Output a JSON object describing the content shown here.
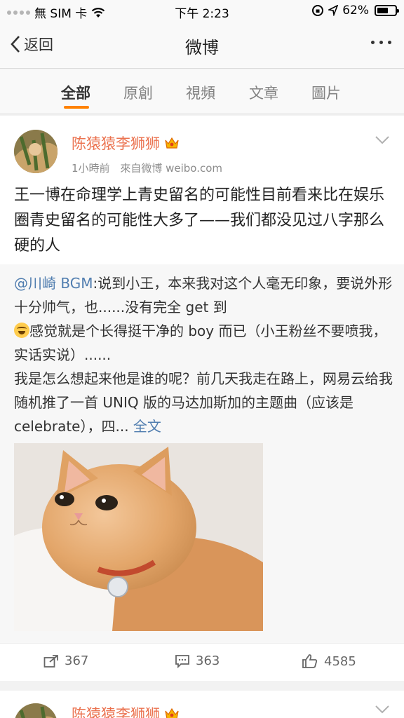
{
  "status_bar": {
    "carrier": "無 SIM 卡",
    "time": "下午 2:23",
    "battery_percent": "62%",
    "battery_level": 0.62
  },
  "nav": {
    "back_label": "返回",
    "title": "微博"
  },
  "tabs": [
    {
      "label": "全部",
      "active": true
    },
    {
      "label": "原創",
      "active": false
    },
    {
      "label": "視頻",
      "active": false
    },
    {
      "label": "文章",
      "active": false
    },
    {
      "label": "圖片",
      "active": false
    }
  ],
  "post": {
    "username": "陈猿猿李狮狮",
    "time_ago": "1小時前",
    "source": "來自微博 weibo.com",
    "text": "王一博在命理学上青史留名的可能性目前看来比在娱乐圈青史留名的可能性大多了——我们都没见过八字那么硬的人",
    "repost": {
      "mention": "@川崎 BGM",
      "text_part1": ":说到小王，本来我对这个人毫无印象，要说外形十分帅气，也......没有完全 get 到",
      "text_part2": "感觉就是个长得挺干净的 boy 而已（小王粉丝不要喷我，实话实说）......",
      "text_part3": "我是怎么想起来他是谁的呢？前几天我走在路上，网易云给我随机推了一首 UNIQ 版的马达加斯加的主题曲（应该是 celebrate），四...",
      "full_text_link": "全文"
    },
    "stats": {
      "reposts": "367",
      "comments": "363",
      "likes": "4585"
    }
  },
  "post2": {
    "username": "陈猿猿李狮狮"
  },
  "colors": {
    "accent": "#ff8200",
    "username": "#eb7350",
    "link": "#507daf"
  }
}
